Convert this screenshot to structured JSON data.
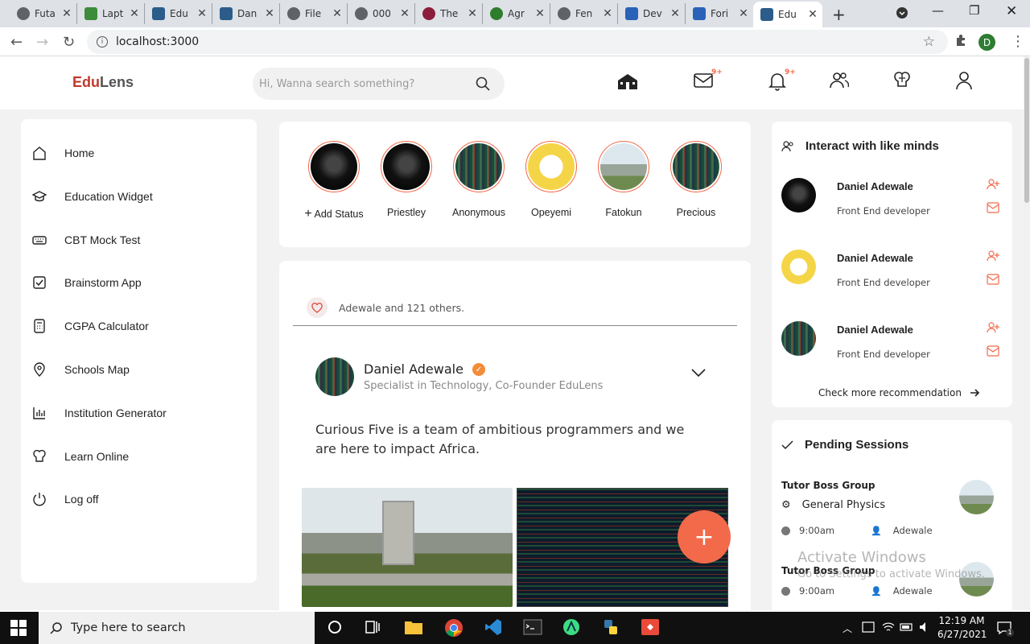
{
  "browser": {
    "tabs": [
      {
        "label": "Futa",
        "favcolor": "#5f6368"
      },
      {
        "label": "Lapt",
        "favcolor": "#3c8c3c"
      },
      {
        "label": "Edu",
        "favcolor": "#2b5c8a"
      },
      {
        "label": "Dan",
        "favcolor": "#2b5c8a"
      },
      {
        "label": "File",
        "favcolor": "#5f6368"
      },
      {
        "label": "000",
        "favcolor": "#5f6368"
      },
      {
        "label": "The",
        "favcolor": "#8b1d3b"
      },
      {
        "label": "Agr",
        "favcolor": "#2d7d2d"
      },
      {
        "label": "Fen",
        "favcolor": "#5f6368"
      },
      {
        "label": "Dev",
        "favcolor": "#2962b8"
      },
      {
        "label": "Fori",
        "favcolor": "#2962b8"
      },
      {
        "label": "Edu",
        "favcolor": "#2b5c8a"
      }
    ],
    "url": "localhost:3000",
    "profile_initial": "D"
  },
  "header": {
    "logo_part1": "Edu",
    "logo_part2": "Lens",
    "search_placeholder": "Hi, Wanna search something?",
    "mail_badge": "9+",
    "notif_badge": "9+"
  },
  "sidebar": {
    "items": [
      {
        "label": "Home",
        "icon": "home-icon"
      },
      {
        "label": "Education Widget",
        "icon": "graduation-cap-icon"
      },
      {
        "label": "CBT Mock Test",
        "icon": "keyboard-icon"
      },
      {
        "label": "Brainstorm App",
        "icon": "checkbox-icon"
      },
      {
        "label": "CGPA Calculator",
        "icon": "calculator-icon"
      },
      {
        "label": "Schools Map",
        "icon": "location-pin-icon"
      },
      {
        "label": "Institution Generator",
        "icon": "bar-chart-icon"
      },
      {
        "label": "Learn Online",
        "icon": "brain-icon"
      },
      {
        "label": "Log off",
        "icon": "power-icon"
      }
    ]
  },
  "stories": [
    {
      "name": "Add Status"
    },
    {
      "name": "Priestley"
    },
    {
      "name": "Anonymous"
    },
    {
      "name": "Opeyemi"
    },
    {
      "name": "Fatokun"
    },
    {
      "name": "Precious"
    }
  ],
  "post": {
    "likes_text": "Adewale and 121 others.",
    "author": "Daniel Adewale",
    "verified_mark": "✓",
    "role": "Specialist in Technology, Co-Founder EduLens",
    "text": "Curious Five is a team of ambitious programmers and we are here to impact Africa.",
    "fab_label": "+"
  },
  "interact": {
    "title": "Interact with like minds",
    "people": [
      {
        "name": "Daniel Adewale",
        "role": "Front End developer"
      },
      {
        "name": "Daniel Adewale",
        "role": "Front End developer"
      },
      {
        "name": "Daniel Adewale",
        "role": "Front End developer"
      }
    ],
    "check_more": "Check more recommendation"
  },
  "pending": {
    "title": "Pending Sessions",
    "sessions": [
      {
        "group": "Tutor Boss Group",
        "subject": "General Physics",
        "time": "9:00am",
        "tutor": "Adewale"
      },
      {
        "group": "Tutor Boss Group",
        "time": "9:00am",
        "tutor": "Adewale"
      }
    ]
  },
  "watermark": {
    "line1": "Activate Windows",
    "line2": "Go to Settings to activate Windows."
  },
  "taskbar": {
    "search_placeholder": "Type here to search",
    "time": "12:19 AM",
    "date": "6/27/2021",
    "notifications": "1"
  },
  "colors": {
    "accent": "#f26a4a",
    "logo_red": "#c0392b"
  }
}
